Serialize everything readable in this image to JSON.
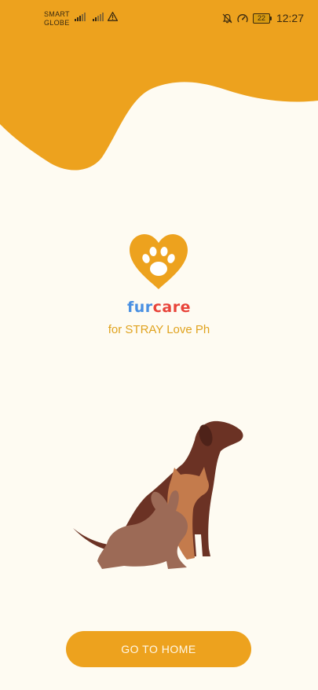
{
  "status_bar": {
    "carrier_line1": "SMART",
    "carrier_line2": "GLOBE",
    "battery_level": "22",
    "time": "12:27"
  },
  "brand": {
    "name_part1": "fur",
    "name_part2": "care",
    "tagline": "for STRAY Love Ph"
  },
  "colors": {
    "accent": "#EDA21E",
    "background": "#FEFBF2",
    "fur": "#4A90E2",
    "care": "#E8443A"
  },
  "cta": {
    "label": "GO TO HOME"
  }
}
